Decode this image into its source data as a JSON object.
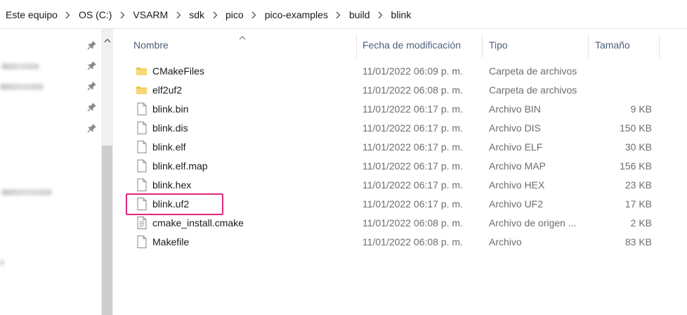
{
  "breadcrumb": [
    "Este equipo",
    "OS (C:)",
    "VSARM",
    "sdk",
    "pico",
    "pico-examples",
    "build",
    "blink"
  ],
  "columns": {
    "name": "Nombre",
    "date": "Fecha de modificación",
    "type": "Tipo",
    "size": "Tamaño"
  },
  "files": [
    {
      "name": "CMakeFiles",
      "date": "11/01/2022 06:09 p. m.",
      "type": "Carpeta de archivos",
      "size": "",
      "icon": "folder-icon"
    },
    {
      "name": "elf2uf2",
      "date": "11/01/2022 06:08 p. m.",
      "type": "Carpeta de archivos",
      "size": "",
      "icon": "folder-icon"
    },
    {
      "name": "blink.bin",
      "date": "11/01/2022 06:17 p. m.",
      "type": "Archivo BIN",
      "size": "9 KB",
      "icon": "file-icon"
    },
    {
      "name": "blink.dis",
      "date": "11/01/2022 06:17 p. m.",
      "type": "Archivo DIS",
      "size": "150 KB",
      "icon": "file-icon"
    },
    {
      "name": "blink.elf",
      "date": "11/01/2022 06:17 p. m.",
      "type": "Archivo ELF",
      "size": "30 KB",
      "icon": "file-icon"
    },
    {
      "name": "blink.elf.map",
      "date": "11/01/2022 06:17 p. m.",
      "type": "Archivo MAP",
      "size": "156 KB",
      "icon": "file-icon"
    },
    {
      "name": "blink.hex",
      "date": "11/01/2022 06:17 p. m.",
      "type": "Archivo HEX",
      "size": "23 KB",
      "icon": "file-icon"
    },
    {
      "name": "blink.uf2",
      "date": "11/01/2022 06:17 p. m.",
      "type": "Archivo UF2",
      "size": "17 KB",
      "icon": "file-icon"
    },
    {
      "name": "cmake_install.cmake",
      "date": "11/01/2022 06:08 p. m.",
      "type": "Archivo de origen ...",
      "size": "2 KB",
      "icon": "text-file-icon"
    },
    {
      "name": "Makefile",
      "date": "11/01/2022 06:08 p. m.",
      "type": "Archivo",
      "size": "83 KB",
      "icon": "file-icon"
    }
  ],
  "highlighted_file": "blink.uf2",
  "colors": {
    "highlight": "#e0287a",
    "header_text": "#4c607a",
    "folder": "#f3c445",
    "secondary_text": "#6d6d6d"
  }
}
